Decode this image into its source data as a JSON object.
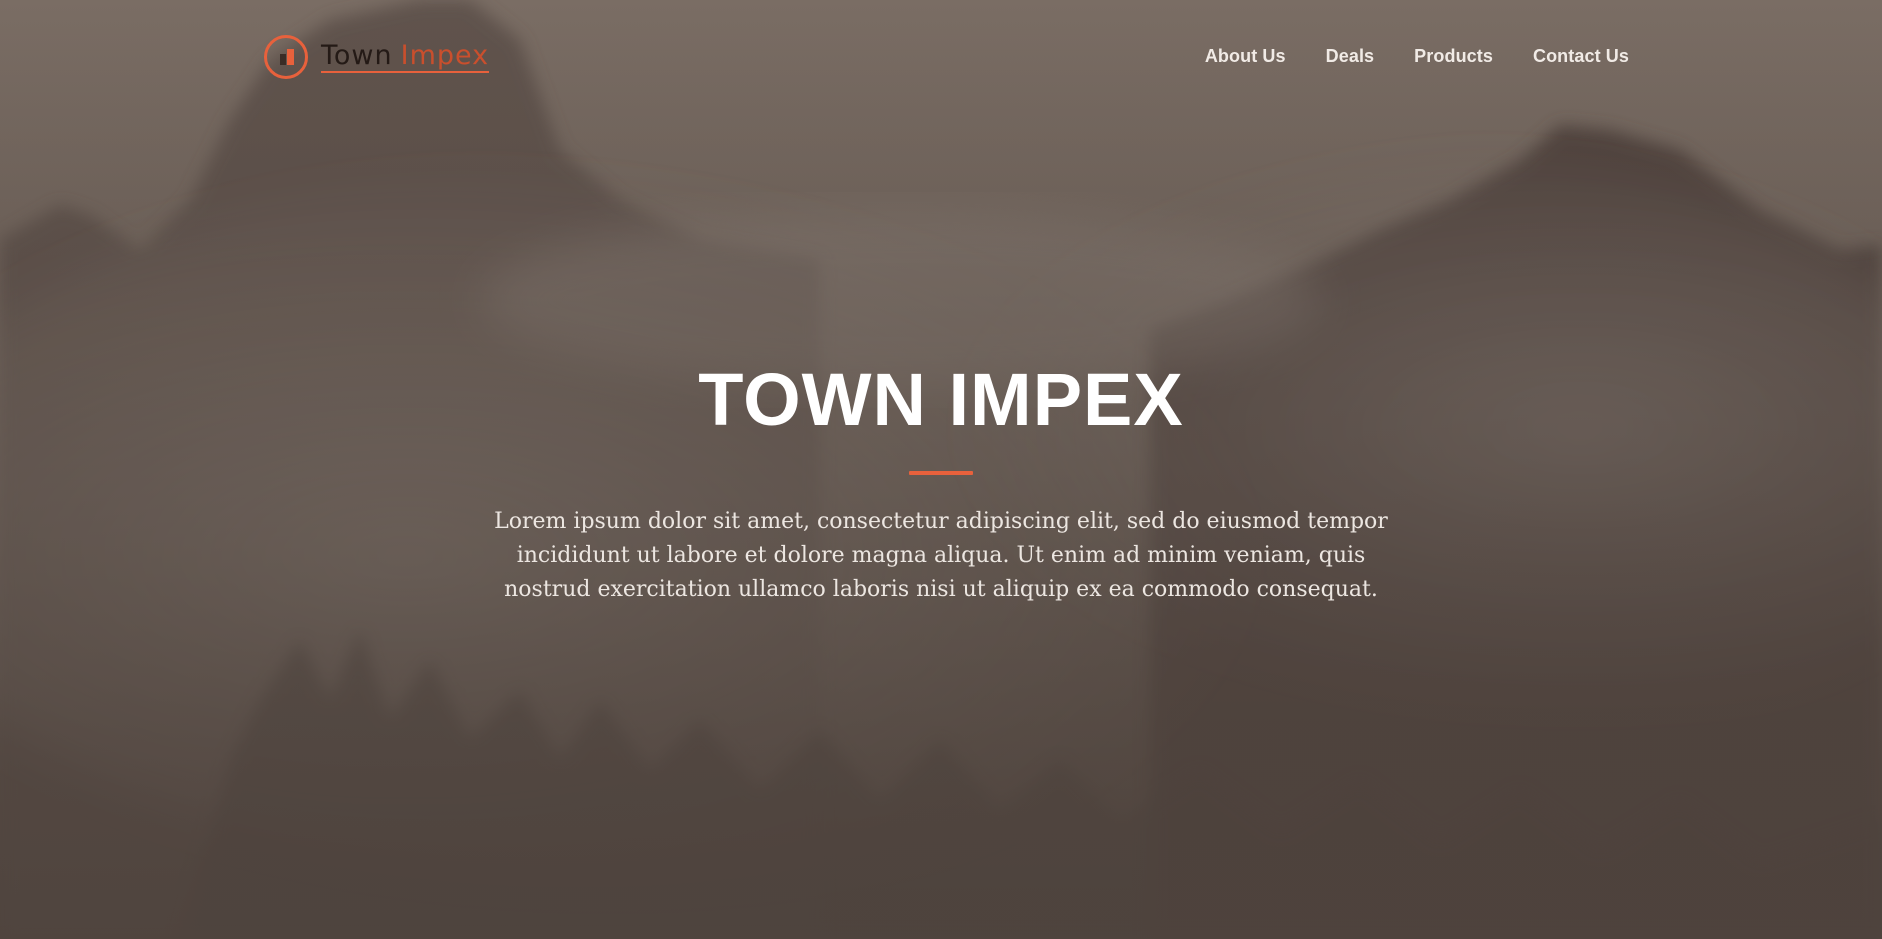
{
  "brand": {
    "name_part1": "Town",
    "name_part2": "Impex"
  },
  "nav": {
    "items": [
      "About Us",
      "Deals",
      "Products",
      "Contact Us"
    ]
  },
  "hero": {
    "title": "TOWN IMPEX",
    "description": "Lorem ipsum dolor sit amet, consectetur adipiscing elit, sed do eiusmod tempor incididunt ut labore et dolore magna aliqua. Ut enim ad minim veniam, quis nostrud exercitation ullamco laboris nisi ut aliquip ex ea commodo consequat."
  },
  "colors": {
    "accent": "#e8613c",
    "overlay": "#6f645c",
    "text": "#ffffff"
  }
}
